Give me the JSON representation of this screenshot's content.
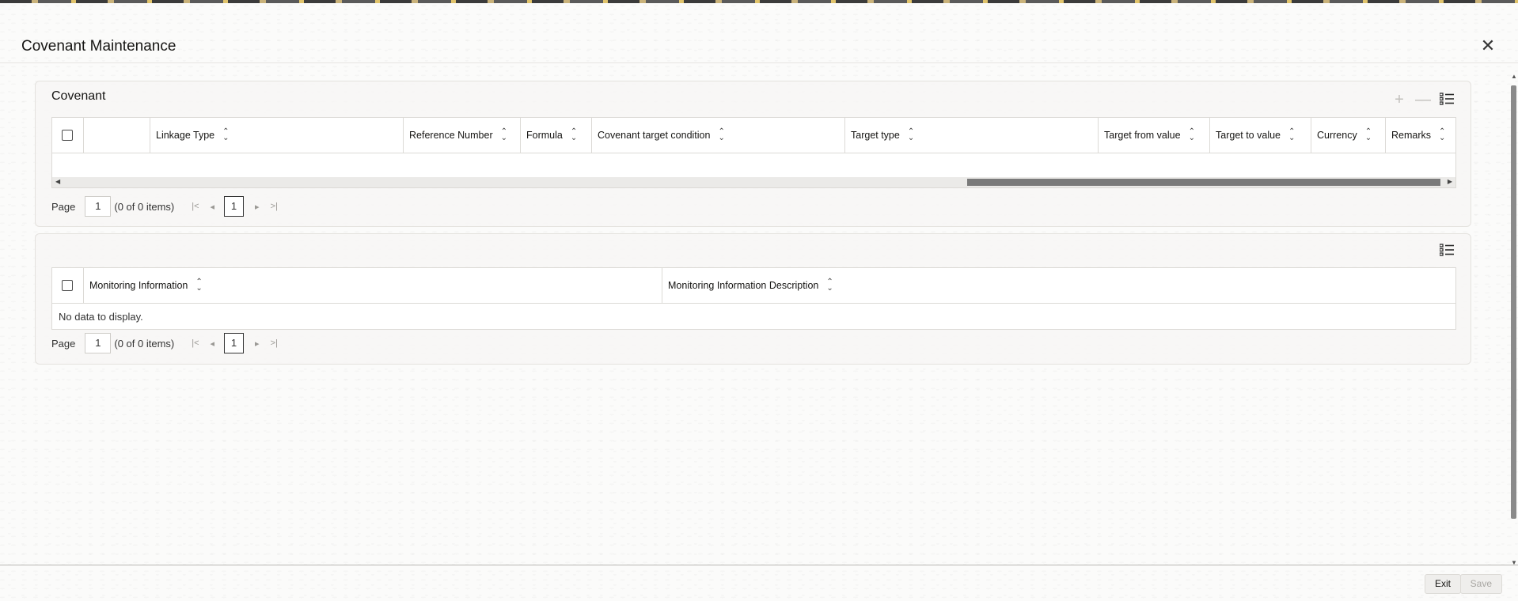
{
  "dialog": {
    "title": "Covenant Maintenance",
    "close_label": "✕"
  },
  "covenant": {
    "title": "Covenant",
    "columns": [
      "",
      "Linkage Type",
      "Reference Number",
      "Formula",
      "Covenant target condition",
      "Target type",
      "Target from value",
      "Target to value",
      "Currency",
      "Remarks"
    ],
    "rows": [],
    "pager": {
      "label": "Page",
      "page_input": "1",
      "items_text": "(0 of 0 items)",
      "current": "1"
    }
  },
  "monitoring": {
    "columns": [
      "Monitoring Information",
      "Monitoring Information Description"
    ],
    "empty_text": "No data to display.",
    "pager": {
      "label": "Page",
      "page_input": "1",
      "items_text": "(0 of 0 items)",
      "current": "1"
    }
  },
  "footer": {
    "exit_label": "Exit",
    "save_label": "Save"
  },
  "icons": {
    "add": "plus-icon",
    "remove": "minus-icon",
    "columns": "column-list-icon",
    "sort": "sort-icon",
    "first": "first-page-icon",
    "prev": "previous-page-icon",
    "next": "next-page-icon",
    "last": "last-page-icon",
    "close": "close-icon"
  },
  "colors": {
    "background": "#fbfbfa",
    "panel_border": "#e4e2de",
    "text": "#161513",
    "scroll_thumb": "#7a7a7a"
  }
}
